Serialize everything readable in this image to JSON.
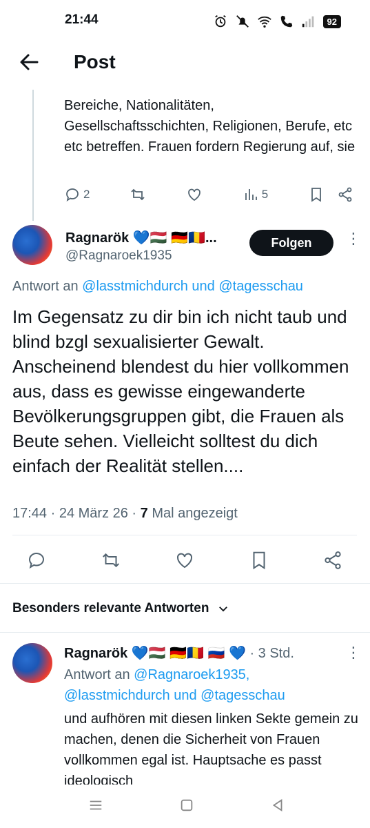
{
  "status_bar": {
    "time": "21:44",
    "battery": "92"
  },
  "header": {
    "title": "Post"
  },
  "prev_tweet": {
    "text": "Bereiche, Nationalitäten, Gesellschaftsschichten, Religionen, Berufe, etc etc betreffen. Frauen fordern Regierung auf, sie",
    "reply_count": "2",
    "views": "5"
  },
  "main_tweet": {
    "name": "Ragnarök 💙🇭🇺 🇩🇪🇷🇴...",
    "handle": "@Ragnaroek1935",
    "follow_label": "Folgen",
    "reply_prefix": "Antwort an ",
    "reply_link": "@lasstmichdurch und @tagesschau",
    "text": "Im Gegensatz zu dir bin ich nicht taub und blind bzgl sexualisierter Gewalt. Anscheinend blendest du hier vollkommen aus, dass es gewisse eingewanderte Bevölkerungsgruppen gibt, die Frauen als Beute sehen. Vielleicht solltest du dich einfach der Realität stellen....",
    "time_date": "17:44 · 24 März 26 · ",
    "views_count": "7",
    "views_label": " Mal angezeigt"
  },
  "relevant_label": "Besonders relevante Antworten",
  "reply": {
    "name": "Ragnarök 💙🇭🇺 🇩🇪🇷🇴 🇷🇺 💙",
    "time": " · 3 Std.",
    "reply_prefix": "Antwort an ",
    "reply_link_1": "@Ragnaroek1935,",
    "reply_link_2": "@lasstmichdurch und @tagesschau",
    "text": "und aufhören mit diesen linken Sekte gemein zu machen, denen die Sicherheit von Frauen vollkommen egal ist. Hauptsache es passt ideologisch"
  },
  "colors": {
    "accent": "#1d9bf0",
    "text": "#0f1419",
    "secondary": "#536471"
  }
}
